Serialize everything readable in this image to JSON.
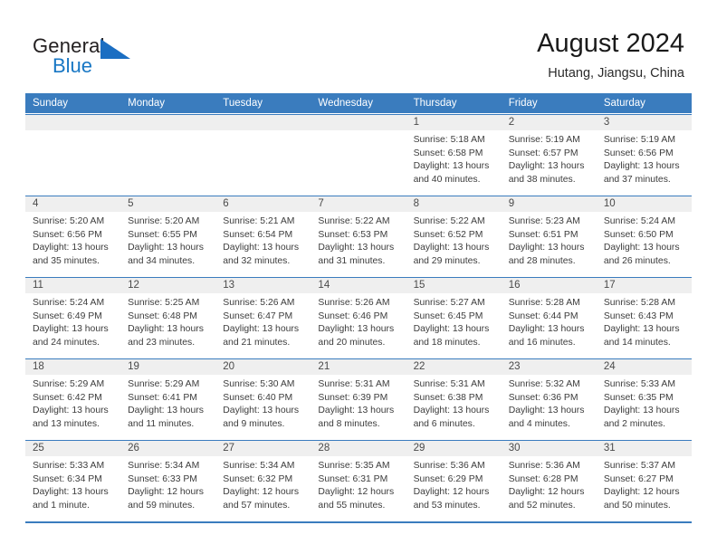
{
  "brand": {
    "name_part1": "General",
    "name_part2": "Blue",
    "accent_color": "#1b6ec2"
  },
  "header": {
    "title": "August 2024",
    "location": "Hutang, Jiangsu, China"
  },
  "calendar": {
    "header_color": "#3a7cbe",
    "weekdays": [
      "Sunday",
      "Monday",
      "Tuesday",
      "Wednesday",
      "Thursday",
      "Friday",
      "Saturday"
    ],
    "weeks": [
      [
        {
          "day": "",
          "lines": []
        },
        {
          "day": "",
          "lines": []
        },
        {
          "day": "",
          "lines": []
        },
        {
          "day": "",
          "lines": []
        },
        {
          "day": "1",
          "lines": [
            "Sunrise: 5:18 AM",
            "Sunset: 6:58 PM",
            "Daylight: 13 hours",
            "and 40 minutes."
          ]
        },
        {
          "day": "2",
          "lines": [
            "Sunrise: 5:19 AM",
            "Sunset: 6:57 PM",
            "Daylight: 13 hours",
            "and 38 minutes."
          ]
        },
        {
          "day": "3",
          "lines": [
            "Sunrise: 5:19 AM",
            "Sunset: 6:56 PM",
            "Daylight: 13 hours",
            "and 37 minutes."
          ]
        }
      ],
      [
        {
          "day": "4",
          "lines": [
            "Sunrise: 5:20 AM",
            "Sunset: 6:56 PM",
            "Daylight: 13 hours",
            "and 35 minutes."
          ]
        },
        {
          "day": "5",
          "lines": [
            "Sunrise: 5:20 AM",
            "Sunset: 6:55 PM",
            "Daylight: 13 hours",
            "and 34 minutes."
          ]
        },
        {
          "day": "6",
          "lines": [
            "Sunrise: 5:21 AM",
            "Sunset: 6:54 PM",
            "Daylight: 13 hours",
            "and 32 minutes."
          ]
        },
        {
          "day": "7",
          "lines": [
            "Sunrise: 5:22 AM",
            "Sunset: 6:53 PM",
            "Daylight: 13 hours",
            "and 31 minutes."
          ]
        },
        {
          "day": "8",
          "lines": [
            "Sunrise: 5:22 AM",
            "Sunset: 6:52 PM",
            "Daylight: 13 hours",
            "and 29 minutes."
          ]
        },
        {
          "day": "9",
          "lines": [
            "Sunrise: 5:23 AM",
            "Sunset: 6:51 PM",
            "Daylight: 13 hours",
            "and 28 minutes."
          ]
        },
        {
          "day": "10",
          "lines": [
            "Sunrise: 5:24 AM",
            "Sunset: 6:50 PM",
            "Daylight: 13 hours",
            "and 26 minutes."
          ]
        }
      ],
      [
        {
          "day": "11",
          "lines": [
            "Sunrise: 5:24 AM",
            "Sunset: 6:49 PM",
            "Daylight: 13 hours",
            "and 24 minutes."
          ]
        },
        {
          "day": "12",
          "lines": [
            "Sunrise: 5:25 AM",
            "Sunset: 6:48 PM",
            "Daylight: 13 hours",
            "and 23 minutes."
          ]
        },
        {
          "day": "13",
          "lines": [
            "Sunrise: 5:26 AM",
            "Sunset: 6:47 PM",
            "Daylight: 13 hours",
            "and 21 minutes."
          ]
        },
        {
          "day": "14",
          "lines": [
            "Sunrise: 5:26 AM",
            "Sunset: 6:46 PM",
            "Daylight: 13 hours",
            "and 20 minutes."
          ]
        },
        {
          "day": "15",
          "lines": [
            "Sunrise: 5:27 AM",
            "Sunset: 6:45 PM",
            "Daylight: 13 hours",
            "and 18 minutes."
          ]
        },
        {
          "day": "16",
          "lines": [
            "Sunrise: 5:28 AM",
            "Sunset: 6:44 PM",
            "Daylight: 13 hours",
            "and 16 minutes."
          ]
        },
        {
          "day": "17",
          "lines": [
            "Sunrise: 5:28 AM",
            "Sunset: 6:43 PM",
            "Daylight: 13 hours",
            "and 14 minutes."
          ]
        }
      ],
      [
        {
          "day": "18",
          "lines": [
            "Sunrise: 5:29 AM",
            "Sunset: 6:42 PM",
            "Daylight: 13 hours",
            "and 13 minutes."
          ]
        },
        {
          "day": "19",
          "lines": [
            "Sunrise: 5:29 AM",
            "Sunset: 6:41 PM",
            "Daylight: 13 hours",
            "and 11 minutes."
          ]
        },
        {
          "day": "20",
          "lines": [
            "Sunrise: 5:30 AM",
            "Sunset: 6:40 PM",
            "Daylight: 13 hours",
            "and 9 minutes."
          ]
        },
        {
          "day": "21",
          "lines": [
            "Sunrise: 5:31 AM",
            "Sunset: 6:39 PM",
            "Daylight: 13 hours",
            "and 8 minutes."
          ]
        },
        {
          "day": "22",
          "lines": [
            "Sunrise: 5:31 AM",
            "Sunset: 6:38 PM",
            "Daylight: 13 hours",
            "and 6 minutes."
          ]
        },
        {
          "day": "23",
          "lines": [
            "Sunrise: 5:32 AM",
            "Sunset: 6:36 PM",
            "Daylight: 13 hours",
            "and 4 minutes."
          ]
        },
        {
          "day": "24",
          "lines": [
            "Sunrise: 5:33 AM",
            "Sunset: 6:35 PM",
            "Daylight: 13 hours",
            "and 2 minutes."
          ]
        }
      ],
      [
        {
          "day": "25",
          "lines": [
            "Sunrise: 5:33 AM",
            "Sunset: 6:34 PM",
            "Daylight: 13 hours",
            "and 1 minute."
          ]
        },
        {
          "day": "26",
          "lines": [
            "Sunrise: 5:34 AM",
            "Sunset: 6:33 PM",
            "Daylight: 12 hours",
            "and 59 minutes."
          ]
        },
        {
          "day": "27",
          "lines": [
            "Sunrise: 5:34 AM",
            "Sunset: 6:32 PM",
            "Daylight: 12 hours",
            "and 57 minutes."
          ]
        },
        {
          "day": "28",
          "lines": [
            "Sunrise: 5:35 AM",
            "Sunset: 6:31 PM",
            "Daylight: 12 hours",
            "and 55 minutes."
          ]
        },
        {
          "day": "29",
          "lines": [
            "Sunrise: 5:36 AM",
            "Sunset: 6:29 PM",
            "Daylight: 12 hours",
            "and 53 minutes."
          ]
        },
        {
          "day": "30",
          "lines": [
            "Sunrise: 5:36 AM",
            "Sunset: 6:28 PM",
            "Daylight: 12 hours",
            "and 52 minutes."
          ]
        },
        {
          "day": "31",
          "lines": [
            "Sunrise: 5:37 AM",
            "Sunset: 6:27 PM",
            "Daylight: 12 hours",
            "and 50 minutes."
          ]
        }
      ]
    ]
  }
}
